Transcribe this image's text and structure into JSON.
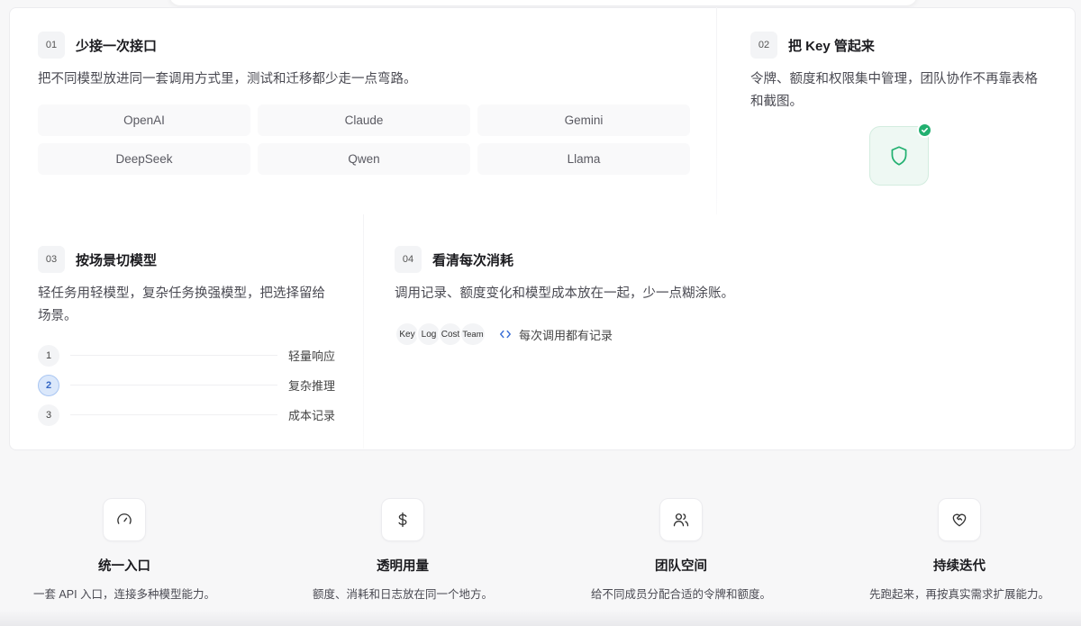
{
  "sections": {
    "s1": {
      "num": "01",
      "title": "少接一次接口",
      "desc": "把不同模型放进同一套调用方式里，测试和迁移都少走一点弯路。",
      "models": [
        "OpenAI",
        "Claude",
        "Gemini",
        "DeepSeek",
        "Qwen",
        "Llama"
      ]
    },
    "s2": {
      "num": "02",
      "title": "把 Key 管起来",
      "desc_line1": "令牌、额度和权限集中管理，团队协作不再靠表格",
      "desc_line2": "和截图。",
      "icon": "shield-icon",
      "badge_icon": "check-icon",
      "accent": "#22b070"
    },
    "s3": {
      "num": "03",
      "title": "按场景切模型",
      "desc_line1": "轻任务用轻模型，复杂任务换强模型，把选择留给",
      "desc_line2": "场景。",
      "steps": [
        {
          "num": "1",
          "label": "轻量响应"
        },
        {
          "num": "2",
          "label": "复杂推理"
        },
        {
          "num": "3",
          "label": "成本记录"
        }
      ],
      "active_step": "2"
    },
    "s4": {
      "num": "04",
      "title": "看清每次消耗",
      "desc": "调用记录、额度变化和模型成本放在一起，少一点糊涂账。",
      "chips": [
        "Key",
        "Log",
        "Cost",
        "Team"
      ],
      "note": "每次调用都有记录",
      "note_icon": "code-icon"
    }
  },
  "features": [
    {
      "icon": "gauge-icon",
      "title": "统一入口",
      "desc": "一套 API 入口，连接多种模型能力。"
    },
    {
      "icon": "dollar-icon",
      "title": "透明用量",
      "desc": "额度、消耗和日志放在同一个地方。"
    },
    {
      "icon": "users-icon",
      "title": "团队空间",
      "desc": "给不同成员分配合适的令牌和额度。"
    },
    {
      "icon": "heart-handshake-icon",
      "title": "持续迭代",
      "desc": "先跑起来，再按真实需求扩展能力。"
    }
  ]
}
